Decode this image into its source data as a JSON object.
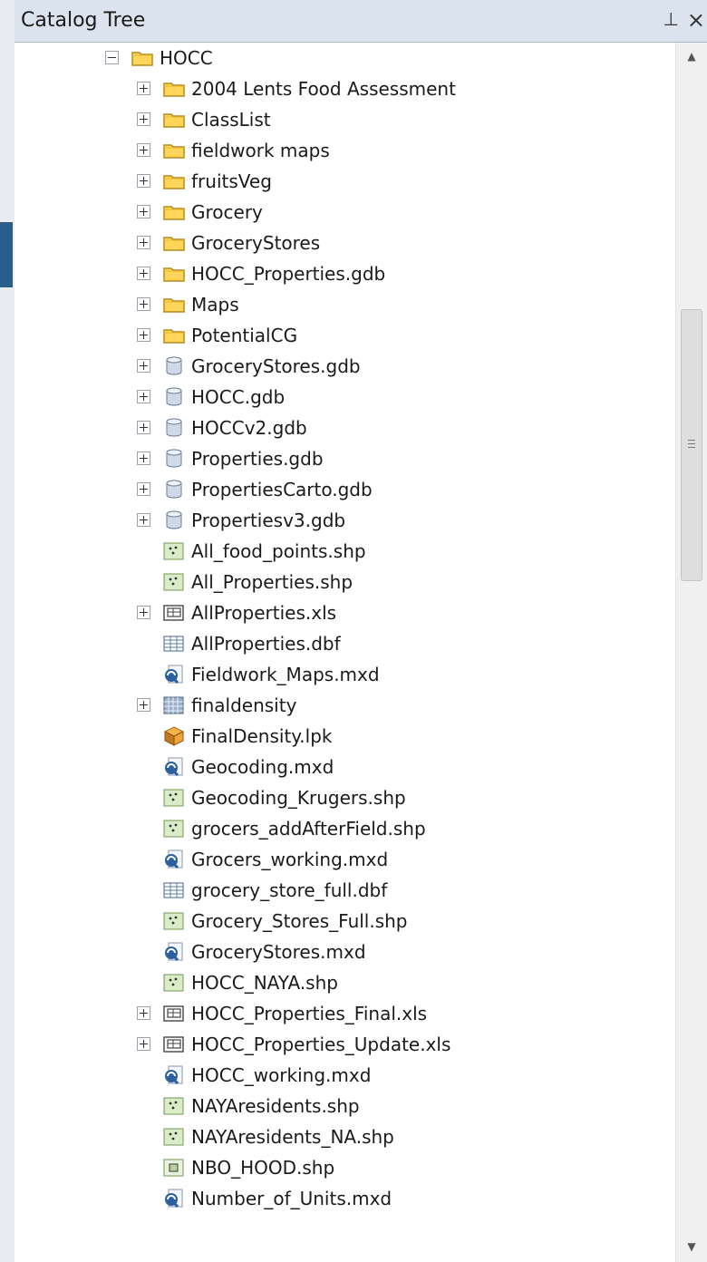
{
  "window": {
    "title": "Catalog Tree",
    "pin": "⊥",
    "close": "×"
  },
  "tree": {
    "root": {
      "label": "HOCC",
      "expanded": true,
      "icon": "folder-icon"
    },
    "items": [
      {
        "label": "2004 Lents Food Assessment",
        "icon": "folder-icon",
        "expandable": true
      },
      {
        "label": "ClassList",
        "icon": "folder-icon",
        "expandable": true
      },
      {
        "label": "fieldwork maps",
        "icon": "folder-icon",
        "expandable": true
      },
      {
        "label": "fruitsVeg",
        "icon": "folder-icon",
        "expandable": true
      },
      {
        "label": "Grocery",
        "icon": "folder-icon",
        "expandable": true
      },
      {
        "label": "GroceryStores",
        "icon": "folder-icon",
        "expandable": true
      },
      {
        "label": "HOCC_Properties.gdb",
        "icon": "folder-icon",
        "expandable": true
      },
      {
        "label": "Maps",
        "icon": "folder-icon",
        "expandable": true
      },
      {
        "label": "PotentialCG",
        "icon": "folder-icon",
        "expandable": true
      },
      {
        "label": "GroceryStores.gdb",
        "icon": "database-icon",
        "expandable": true
      },
      {
        "label": "HOCC.gdb",
        "icon": "database-icon",
        "expandable": true
      },
      {
        "label": "HOCCv2.gdb",
        "icon": "database-icon",
        "expandable": true
      },
      {
        "label": "Properties.gdb",
        "icon": "database-icon",
        "expandable": true
      },
      {
        "label": "PropertiesCarto.gdb",
        "icon": "database-icon",
        "expandable": true
      },
      {
        "label": "Propertiesv3.gdb",
        "icon": "database-icon",
        "expandable": true
      },
      {
        "label": "All_food_points.shp",
        "icon": "point-shapefile-icon",
        "expandable": false
      },
      {
        "label": "All_Properties.shp",
        "icon": "point-shapefile-icon",
        "expandable": false
      },
      {
        "label": "AllProperties.xls",
        "icon": "excel-table-icon",
        "expandable": true
      },
      {
        "label": "AllProperties.dbf",
        "icon": "dbf-table-icon",
        "expandable": false
      },
      {
        "label": "Fieldwork_Maps.mxd",
        "icon": "map-document-icon",
        "expandable": false
      },
      {
        "label": "finaldensity",
        "icon": "raster-icon",
        "expandable": true
      },
      {
        "label": "FinalDensity.lpk",
        "icon": "layer-package-icon",
        "expandable": false
      },
      {
        "label": "Geocoding.mxd",
        "icon": "map-document-icon",
        "expandable": false
      },
      {
        "label": "Geocoding_Krugers.shp",
        "icon": "point-shapefile-icon",
        "expandable": false
      },
      {
        "label": "grocers_addAfterField.shp",
        "icon": "point-shapefile-icon",
        "expandable": false
      },
      {
        "label": "Grocers_working.mxd",
        "icon": "map-document-icon",
        "expandable": false
      },
      {
        "label": "grocery_store_full.dbf",
        "icon": "dbf-table-icon",
        "expandable": false
      },
      {
        "label": "Grocery_Stores_Full.shp",
        "icon": "point-shapefile-icon",
        "expandable": false
      },
      {
        "label": "GroceryStores.mxd",
        "icon": "map-document-icon",
        "expandable": false
      },
      {
        "label": "HOCC_NAYA.shp",
        "icon": "point-shapefile-icon",
        "expandable": false
      },
      {
        "label": "HOCC_Properties_Final.xls",
        "icon": "excel-table-icon",
        "expandable": true
      },
      {
        "label": "HOCC_Properties_Update.xls",
        "icon": "excel-table-icon",
        "expandable": true
      },
      {
        "label": "HOCC_working.mxd",
        "icon": "map-document-icon",
        "expandable": false
      },
      {
        "label": "NAYAresidents.shp",
        "icon": "point-shapefile-icon",
        "expandable": false
      },
      {
        "label": "NAYAresidents_NA.shp",
        "icon": "point-shapefile-icon",
        "expandable": false
      },
      {
        "label": "NBO_HOOD.shp",
        "icon": "polygon-shapefile-icon",
        "expandable": false
      },
      {
        "label": "Number_of_Units.mxd",
        "icon": "map-document-icon",
        "expandable": false
      }
    ]
  },
  "scrollbar": {
    "up_arrow": "▲",
    "down_arrow": "▼"
  }
}
